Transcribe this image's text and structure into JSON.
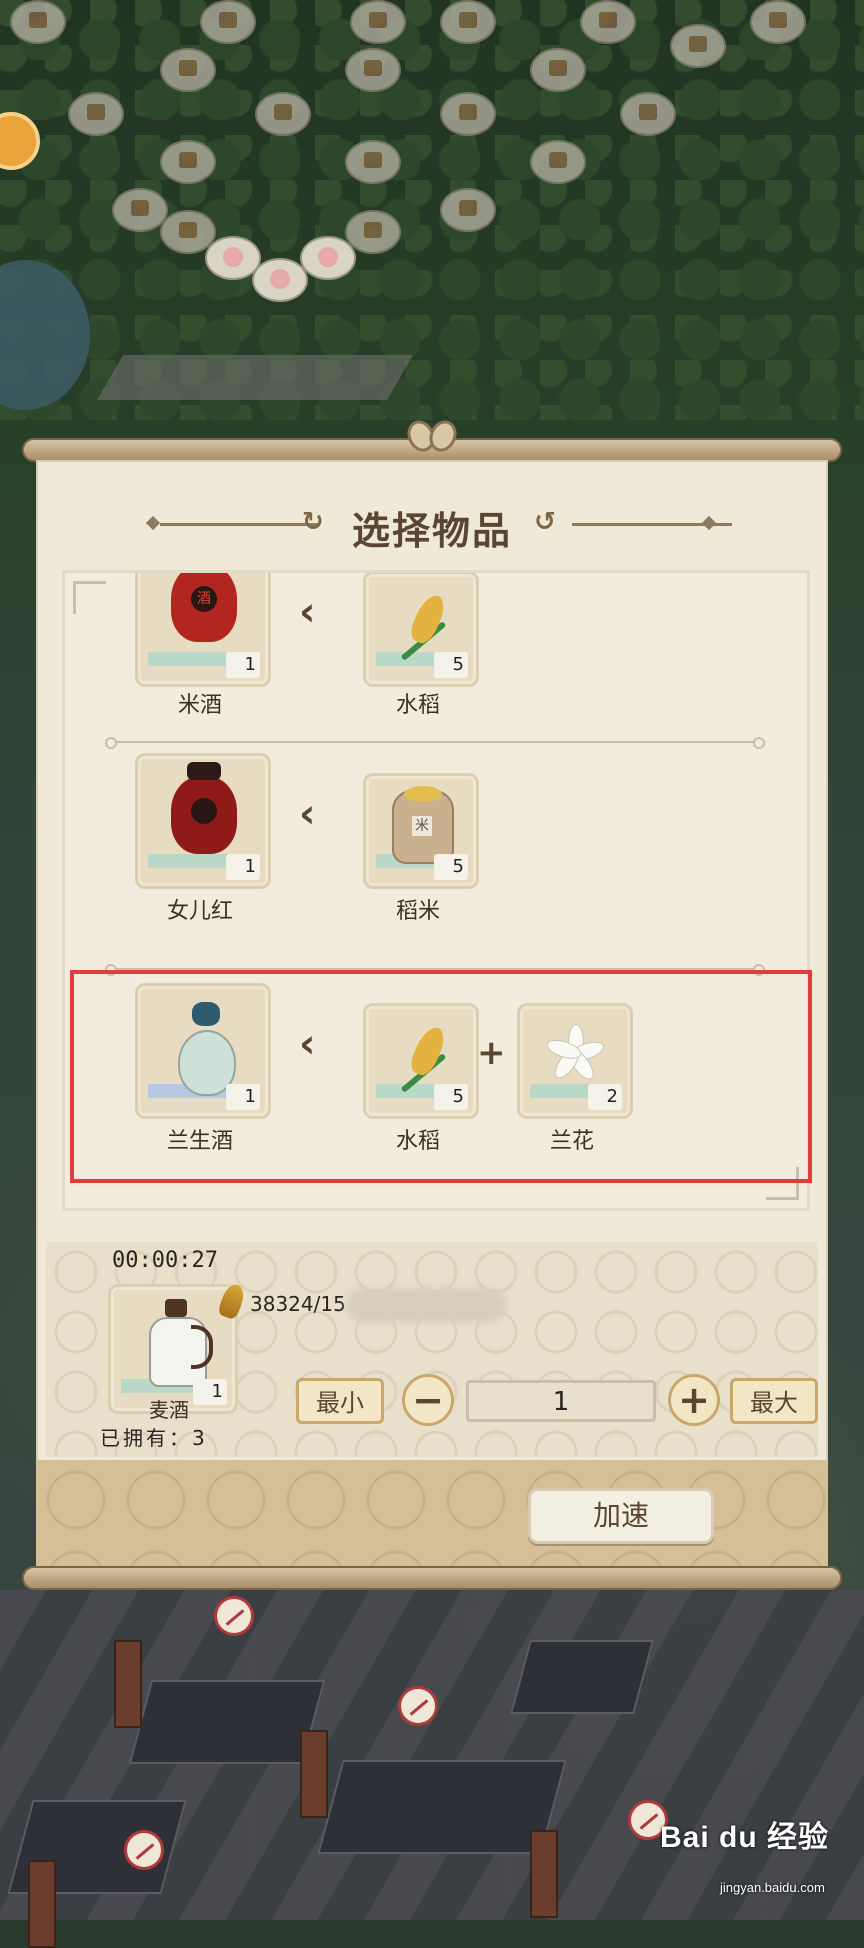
{
  "dialog": {
    "title": "选择物品"
  },
  "recipes": [
    {
      "product": {
        "name": "米酒",
        "qty": "1",
        "icon": "rice-wine-jar-icon"
      },
      "ingredients": [
        {
          "name": "水稻",
          "qty": "5",
          "icon": "rice-plant-icon"
        }
      ]
    },
    {
      "product": {
        "name": "女儿红",
        "qty": "1",
        "icon": "nuerhong-wine-jar-icon"
      },
      "ingredients": [
        {
          "name": "稻米",
          "qty": "5",
          "icon": "rice-sack-icon"
        }
      ]
    },
    {
      "product": {
        "name": "兰生酒",
        "qty": "1",
        "icon": "lansheng-wine-gourd-icon"
      },
      "ingredients": [
        {
          "name": "水稻",
          "qty": "5",
          "icon": "rice-plant-icon"
        },
        {
          "name": "兰花",
          "qty": "2",
          "icon": "orchid-flower-icon"
        }
      ]
    }
  ],
  "production": {
    "timer": "00:00:27",
    "current_item": {
      "name": "麦酒",
      "qty": "1",
      "icon": "wheat-wine-bottle-icon"
    },
    "owned": "已拥有：3",
    "resource": "38324/15",
    "min_label": "最小",
    "max_label": "最大",
    "quantity": "1",
    "speedup_label": "加速"
  },
  "colors": {
    "highlight": "#e23c3c",
    "title_text": "#5a4630",
    "panel_bg": "#efe9d8"
  },
  "watermark": {
    "brand": "Bai du 经验",
    "url": "jingyan.baidu.com"
  }
}
